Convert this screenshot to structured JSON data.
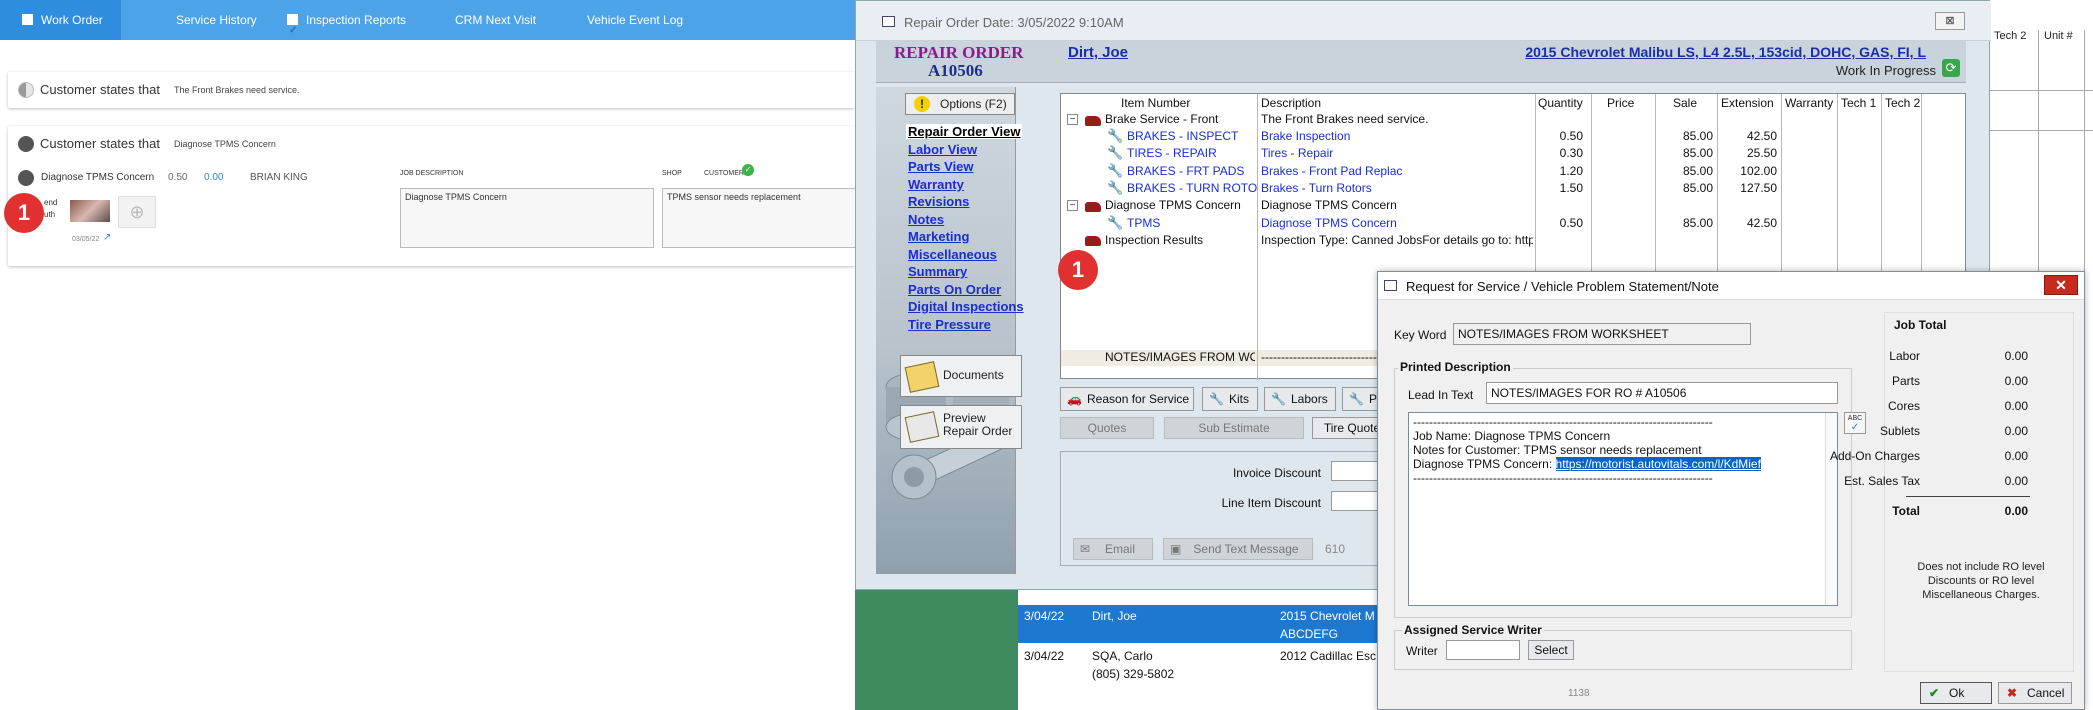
{
  "webapp": {
    "tabs": [
      {
        "label": "Work Order",
        "checkbox": true,
        "checked": false
      },
      {
        "label": "Service History"
      },
      {
        "label": "Inspection Reports",
        "checkbox": true,
        "checked": true
      },
      {
        "label": "CRM Next Visit"
      },
      {
        "label": "Vehicle Event Log"
      }
    ],
    "concern1": {
      "prefix": "Customer states that",
      "text": "The Front Brakes need service."
    },
    "concern2": {
      "prefix": "Customer states that",
      "text": "Diagnose TPMS Concern"
    },
    "job": {
      "name": "Diagnose TPMS Concern",
      "hours": "0.50",
      "amount": "0.00",
      "tech": "BRIAN KING",
      "send_label": "end",
      "auth_label": "uth",
      "photo_date": "03/05/22",
      "job_desc_label": "JOB DESCRIPTION",
      "job_desc_value": "Diagnose TPMS Concern",
      "shop_label": "SHOP",
      "customer_label": "CUSTOMER",
      "customer_value": "TPMS sensor needs replacement"
    },
    "badge_number": "1"
  },
  "ro_window": {
    "title": "Repair Order Date: 3/05/2022 9:10AM",
    "ro_label": "REPAIR ORDER",
    "ro_number": "A10506",
    "customer": "Dirt, Joe",
    "vehicle": "2015 Chevrolet Malibu LS, L4 2.5L, 153cid, DOHC, GAS, FI, L",
    "status": "Work In Progress",
    "options_label": "Options (F2)",
    "sidebar_links": [
      "Repair Order View",
      "Labor View",
      "Parts View",
      "Warranty",
      "Revisions",
      "Notes",
      "Marketing",
      "Miscellaneous",
      "Summary",
      "Parts On Order",
      "Digital Inspections",
      "Tire Pressure"
    ],
    "documents_label": "Documents",
    "preview_label": "Preview Repair Order",
    "grid_headers": [
      "Item Number",
      "Description",
      "Quantity",
      "Price",
      "Sale",
      "Extension",
      "Warranty",
      "Tech 1",
      "Tech 2"
    ],
    "rows": [
      {
        "item": "Brake Service - Front",
        "desc": "The Front Brakes need service.",
        "qty": "",
        "sale": "",
        "ext": ""
      },
      {
        "item": "BRAKES -  INSPECT",
        "desc": "Brake Inspection",
        "qty": "0.50",
        "sale": "85.00",
        "ext": "42.50"
      },
      {
        "item": "TIRES - REPAIR",
        "desc": "Tires - Repair",
        "qty": "0.30",
        "sale": "85.00",
        "ext": "25.50"
      },
      {
        "item": "BRAKES - FRT PADS",
        "desc": "Brakes - Front Pad Replac",
        "qty": "1.20",
        "sale": "85.00",
        "ext": "102.00"
      },
      {
        "item": "BRAKES - TURN ROTO",
        "desc": "Brakes - Turn Rotors",
        "qty": "1.50",
        "sale": "85.00",
        "ext": "127.50"
      },
      {
        "item": "Diagnose TPMS Concern",
        "desc": "Diagnose TPMS Concern",
        "qty": "",
        "sale": "",
        "ext": ""
      },
      {
        "item": "TPMS",
        "desc": "Diagnose TPMS Concern",
        "qty": "0.50",
        "sale": "85.00",
        "ext": "42.50"
      },
      {
        "item": "Inspection Results",
        "desc": "Inspection Type: Canned JobsFor details go to: http",
        "qty": "",
        "sale": "",
        "ext": ""
      },
      {
        "item": "NOTES/IMAGES FROM WOR",
        "desc": "------------------------------------------------",
        "qty": "",
        "sale": "",
        "ext": ""
      }
    ],
    "action_buttons": [
      "Reason for Service",
      "Kits",
      "Labors",
      "P"
    ],
    "secondary_buttons": [
      "Quotes",
      "Sub Estimate",
      "Tire Quote"
    ],
    "invoice_discount_label": "Invoice Discount",
    "line_item_discount_label": "Line Item Discount",
    "email_label": "Email",
    "send_text_label": "Send Text Message",
    "sms_count": "610",
    "close_glyph": "⊠"
  },
  "bg_list": {
    "rows": [
      {
        "date": "3/04/22",
        "name": "Dirt, Joe",
        "vehicle": "2015 Chevrolet  M",
        "line2": "ABCDEFG"
      },
      {
        "date": "3/04/22",
        "name": "SQA, Carlo",
        "vehicle": "2012 Cadillac  Esc",
        "line2": "(805) 329-5802"
      }
    ]
  },
  "bg_grid": {
    "headers": [
      "Tech 2",
      "Unit #"
    ]
  },
  "dialog": {
    "title": "Request for Service / Vehicle Problem Statement/Note",
    "keyword_label": "Key Word",
    "keyword_value": "NOTES/IMAGES FROM WORKSHEET",
    "printed_desc_label": "Printed Description",
    "lead_in_label": "Lead In Text",
    "lead_in_value": "NOTES/IMAGES FOR RO # A10506",
    "memo_sep": "---------------------------------------------------------------------------",
    "memo_line1": "Job Name: Diagnose TPMS Concern",
    "memo_line2": "Notes for Customer: TPMS sensor needs replacement",
    "memo_line3_prefix": "Diagnose TPMS Concern: ",
    "memo_url": "https://motorist.autovitals.com/l/KdMief",
    "writer_group": "Assigned Service Writer",
    "writer_label": "Writer",
    "select_label": "Select",
    "footer_num": "1138",
    "job_total_label": "Job Total",
    "totals": [
      {
        "label": "Labor",
        "value": "0.00"
      },
      {
        "label": "Parts",
        "value": "0.00"
      },
      {
        "label": "Cores",
        "value": "0.00"
      },
      {
        "label": "Sublets",
        "value": "0.00"
      },
      {
        "label": "Add-On Charges",
        "value": "0.00"
      },
      {
        "label": "Est. Sales Tax",
        "value": "0.00"
      }
    ],
    "total_label": "Total",
    "total_value": "0.00",
    "note": "Does not include RO level Discounts or RO level Miscellaneous Charges.",
    "ok_label": "Ok",
    "cancel_label": "Cancel",
    "spell_label": "ABC"
  }
}
